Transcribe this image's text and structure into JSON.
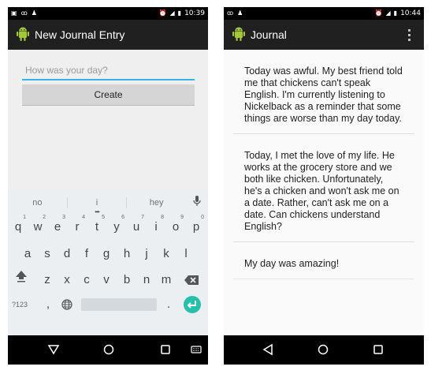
{
  "left": {
    "status": {
      "time": "10:39"
    },
    "appbar": {
      "title": "New Journal Entry"
    },
    "form": {
      "placeholder": "How was your day?",
      "create_label": "Create"
    },
    "keyboard": {
      "suggestions": [
        "no",
        "i",
        "hey"
      ],
      "row1": [
        "q",
        "w",
        "e",
        "r",
        "t",
        "y",
        "u",
        "i",
        "o",
        "p"
      ],
      "row1_hints": [
        "1",
        "2",
        "3",
        "4",
        "5",
        "6",
        "7",
        "8",
        "9",
        "0"
      ],
      "row2": [
        "a",
        "s",
        "d",
        "f",
        "g",
        "h",
        "j",
        "k",
        "l"
      ],
      "row3": [
        "z",
        "x",
        "c",
        "v",
        "b",
        "n",
        "m"
      ],
      "symbols_label": "?123",
      "comma": ",",
      "period": "."
    }
  },
  "right": {
    "status": {
      "time": "10:44"
    },
    "appbar": {
      "title": "Journal"
    },
    "entries": [
      "Today was awful. My best friend told me that chickens can't speak English. I'm currently listening to Nickelback as a reminder that some things are worse than my day today.",
      "Today, I met the love of my life. He works at the grocery store and we both like chicken. Unfortunately, he's a chicken and won't ask me on a date. Rather, can't ask me on a date. Can chickens understand English?",
      "My day was amazing!"
    ]
  },
  "colors": {
    "accent": "#33b5e5",
    "enter": "#26bfa9",
    "android": "#a4c639"
  }
}
